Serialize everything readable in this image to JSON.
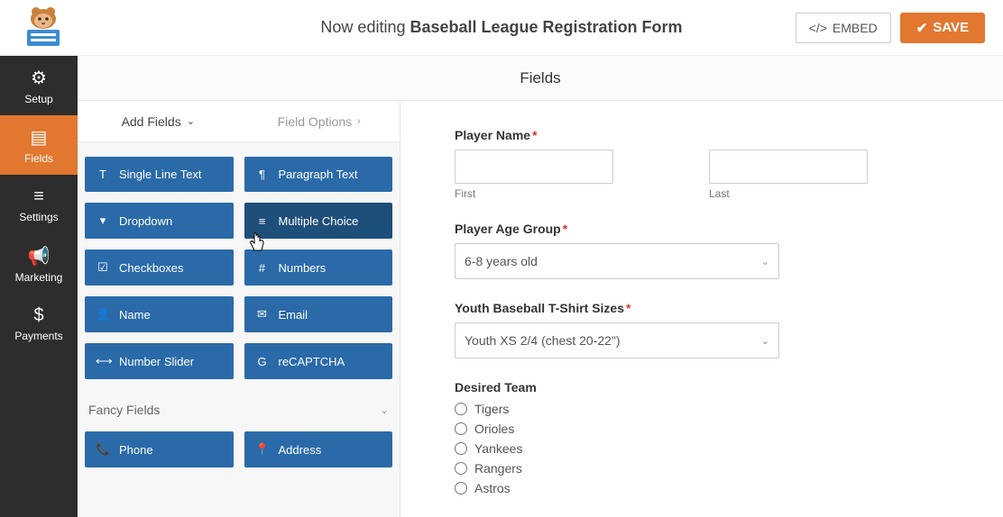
{
  "header": {
    "prefix": "Now editing ",
    "title": "Baseball League Registration Form",
    "embed": "EMBED",
    "save": "SAVE"
  },
  "sectionHeader": "Fields",
  "sidenav": [
    {
      "id": "setup",
      "label": "Setup",
      "icon": "⚙"
    },
    {
      "id": "fields",
      "label": "Fields",
      "icon": "▤"
    },
    {
      "id": "settings",
      "label": "Settings",
      "icon": "≡"
    },
    {
      "id": "marketing",
      "label": "Marketing",
      "icon": "📢"
    },
    {
      "id": "payments",
      "label": "Payments",
      "icon": "$"
    }
  ],
  "tabs": {
    "addFields": "Add Fields",
    "fieldOptions": "Field Options"
  },
  "standardFields": [
    {
      "id": "single-line-text",
      "label": "Single Line Text",
      "icon": "T"
    },
    {
      "id": "paragraph-text",
      "label": "Paragraph Text",
      "icon": "¶"
    },
    {
      "id": "dropdown",
      "label": "Dropdown",
      "icon": "▾"
    },
    {
      "id": "multiple-choice",
      "label": "Multiple Choice",
      "icon": "≡"
    },
    {
      "id": "checkboxes",
      "label": "Checkboxes",
      "icon": "☑"
    },
    {
      "id": "numbers",
      "label": "Numbers",
      "icon": "#"
    },
    {
      "id": "name",
      "label": "Name",
      "icon": "👤"
    },
    {
      "id": "email",
      "label": "Email",
      "icon": "✉"
    },
    {
      "id": "number-slider",
      "label": "Number Slider",
      "icon": "⟷"
    },
    {
      "id": "recaptcha",
      "label": "reCAPTCHA",
      "icon": "G"
    }
  ],
  "fancyTitle": "Fancy Fields",
  "fancyFields": [
    {
      "id": "phone",
      "label": "Phone",
      "icon": "📞"
    },
    {
      "id": "address",
      "label": "Address",
      "icon": "📍"
    }
  ],
  "form": {
    "playerName": {
      "label": "Player Name",
      "first": "First",
      "last": "Last"
    },
    "ageGroup": {
      "label": "Player Age Group",
      "value": "6-8 years old"
    },
    "tshirt": {
      "label": "Youth Baseball T-Shirt Sizes",
      "value": "Youth XS  2/4 (chest 20-22\")"
    },
    "desiredTeam": {
      "label": "Desired Team",
      "options": [
        "Tigers",
        "Orioles",
        "Yankees",
        "Rangers",
        "Astros"
      ]
    }
  }
}
